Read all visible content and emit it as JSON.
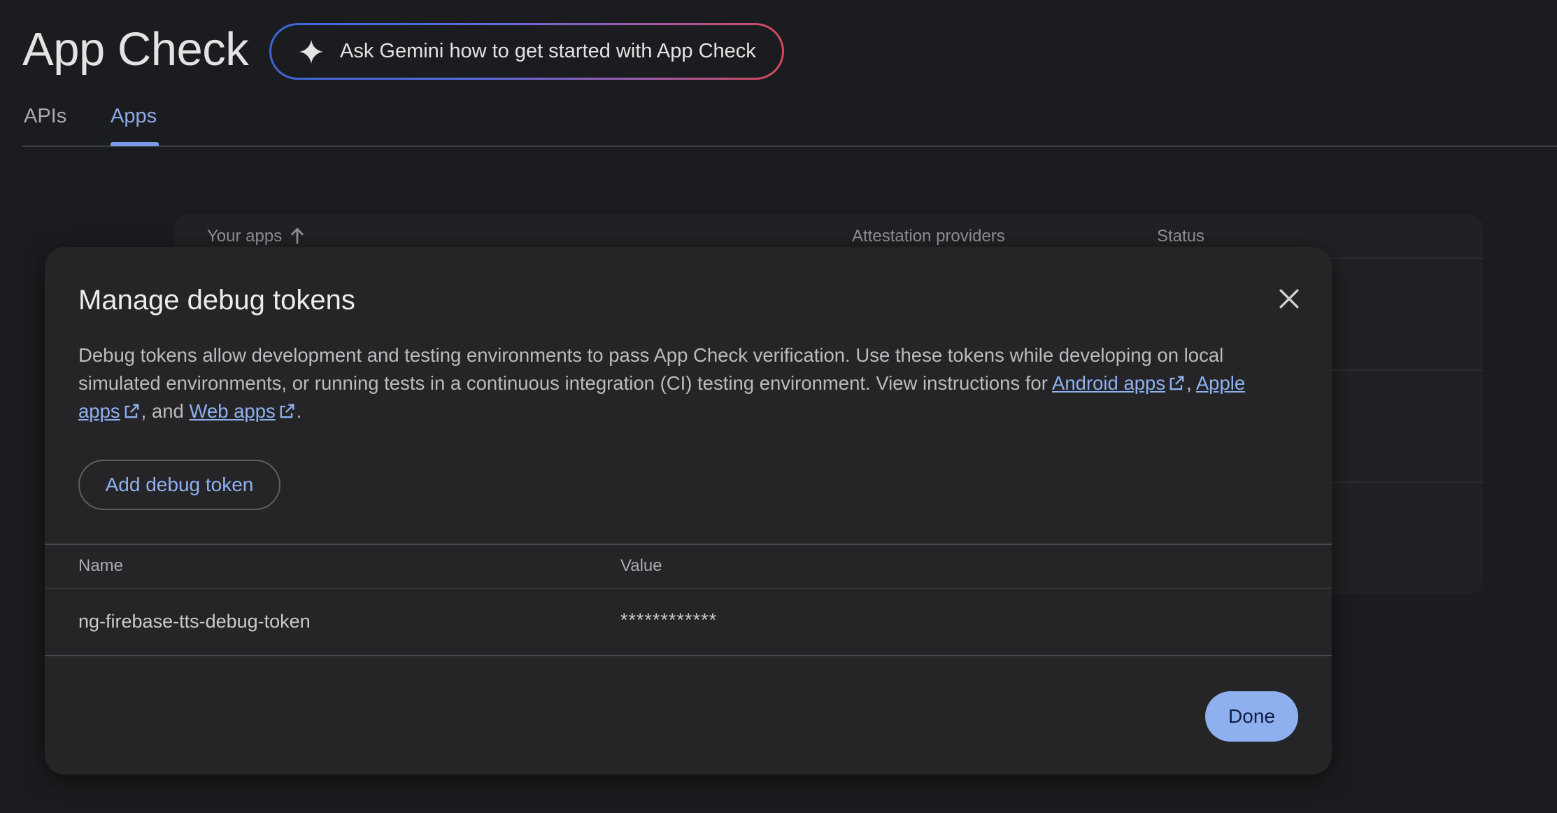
{
  "header": {
    "title": "App Check",
    "gemini_button": "Ask Gemini how to get started with App Check"
  },
  "tabs": [
    {
      "label": "APIs",
      "active": false
    },
    {
      "label": "Apps",
      "active": true
    }
  ],
  "apps_table": {
    "columns": [
      "Your apps",
      "Attestation providers",
      "Status"
    ],
    "sort_icon": "arrow-up-icon"
  },
  "dialog": {
    "title": "Manage debug tokens",
    "description_part1": "Debug tokens allow development and testing environments to pass App Check verification. Use these tokens while developing on local simulated environments, or running tests in a continuous integration (CI) testing environment. View instructions for",
    "link_android": "Android apps",
    "sep1": ",",
    "link_apple": "Apple apps",
    "sep2": ", and",
    "link_web": "Web apps",
    "end": ".",
    "add_button": "Add debug token",
    "table": {
      "headers": [
        "Name",
        "Value"
      ],
      "rows": [
        {
          "name": "ng-firebase-tts-debug-token",
          "value": "************"
        }
      ]
    },
    "done_button": "Done"
  },
  "colors": {
    "background": "#1b1c1f",
    "dialog": "#252527",
    "accent": "#8fb0ef"
  }
}
